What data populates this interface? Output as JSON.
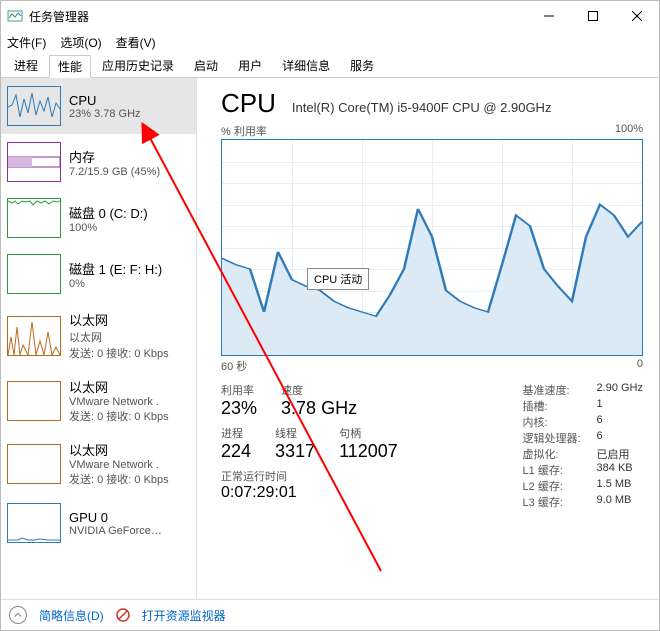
{
  "window": {
    "title": "任务管理器"
  },
  "menu": {
    "file": "文件(F)",
    "options": "选项(O)",
    "view": "查看(V)"
  },
  "tabs": [
    "进程",
    "性能",
    "应用历史记录",
    "启动",
    "用户",
    "详细信息",
    "服务"
  ],
  "sidebar": {
    "items": [
      {
        "name": "CPU",
        "sub": "23% 3.78 GHz",
        "color": "#2f7ab8"
      },
      {
        "name": "内存",
        "sub": "7.2/15.9 GB (45%)",
        "color": "#8b2fa0"
      },
      {
        "name": "磁盘 0 (C: D:)",
        "sub": "100%",
        "color": "#2f9a3e"
      },
      {
        "name": "磁盘 1 (E: F: H:)",
        "sub": "0%",
        "color": "#2f9a3e"
      },
      {
        "name": "以太网",
        "sub": "以太网\n发送: 0 接收: 0 Kbps",
        "color": "#b86a1f"
      },
      {
        "name": "以太网",
        "sub": "VMware Network .\n发送: 0 接收: 0 Kbps",
        "color": "#b86a1f"
      },
      {
        "name": "以太网",
        "sub": "VMware Network .\n发送: 0 接收: 0 Kbps",
        "color": "#b86a1f"
      },
      {
        "name": "GPU 0",
        "sub": "NVIDIA GeForce…",
        "color": "#2f7ab8"
      }
    ]
  },
  "main": {
    "title": "CPU",
    "subtitle": "Intel(R) Core(TM) i5-9400F CPU @ 2.90GHz",
    "chart_top_left": "% 利用率",
    "chart_top_right": "100%",
    "chart_bottom_left": "60 秒",
    "chart_bottom_right": "0",
    "tooltip": "CPU 活动",
    "stats1": [
      {
        "label": "利用率",
        "value": "23%"
      },
      {
        "label": "速度",
        "value": "3.78 GHz"
      }
    ],
    "stats2": [
      {
        "label": "进程",
        "value": "224"
      },
      {
        "label": "线程",
        "value": "3317"
      },
      {
        "label": "句柄",
        "value": "112007"
      }
    ],
    "uptime_label": "正常运行时间",
    "uptime_value": "0:07:29:01",
    "right": [
      {
        "k": "基准速度:",
        "v": "2.90 GHz"
      },
      {
        "k": "插槽:",
        "v": "1"
      },
      {
        "k": "内核:",
        "v": "6"
      },
      {
        "k": "逻辑处理器:",
        "v": "6"
      },
      {
        "k": "虚拟化:",
        "v": "已启用"
      },
      {
        "k": "L1 缓存:",
        "v": "384 KB"
      },
      {
        "k": "L2 缓存:",
        "v": "1.5 MB"
      },
      {
        "k": "L3 缓存:",
        "v": "9.0 MB"
      }
    ]
  },
  "footer": {
    "less": "简略信息(D)",
    "resmon": "打开资源监视器"
  },
  "chart_data": {
    "type": "line",
    "title": "% 利用率",
    "ylabel": "%",
    "ylim": [
      0,
      100
    ],
    "xlabel": "秒",
    "xlim": [
      60,
      0
    ],
    "x": [
      60,
      58,
      56,
      54,
      52,
      50,
      48,
      46,
      44,
      42,
      40,
      38,
      36,
      34,
      32,
      30,
      28,
      26,
      24,
      22,
      20,
      18,
      16,
      14,
      12,
      10,
      8,
      6,
      4,
      2,
      0
    ],
    "values": [
      45,
      42,
      40,
      20,
      48,
      35,
      32,
      30,
      25,
      22,
      20,
      18,
      28,
      40,
      68,
      55,
      30,
      25,
      22,
      20,
      42,
      65,
      60,
      40,
      32,
      25,
      55,
      70,
      65,
      55,
      62
    ]
  }
}
